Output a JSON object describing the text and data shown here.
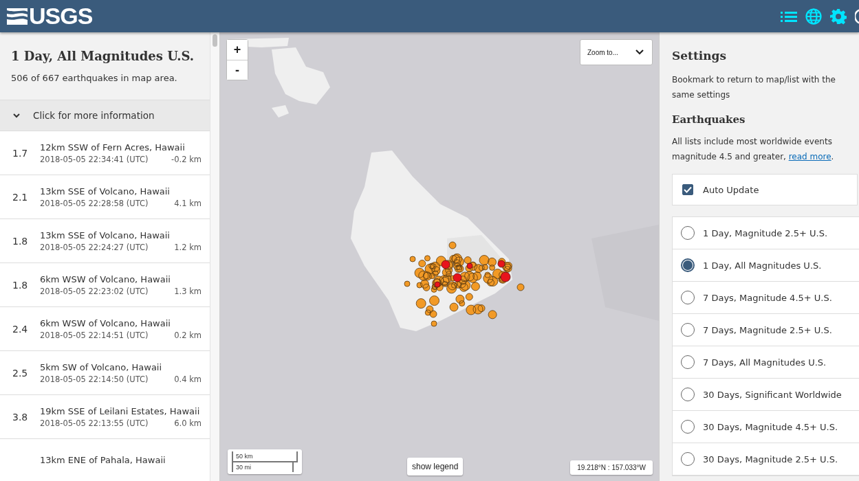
{
  "header": {
    "logo": "USGS"
  },
  "list_panel": {
    "title": "1 Day, All Magnitudes U.S.",
    "summary": "506 of 667 earthquakes in map area.",
    "info_toggle": {
      "label": "Click for more information",
      "expanded": false
    },
    "events": [
      {
        "magnitude": "1.7",
        "place": "12km SSW of Fern Acres, Hawaii",
        "time": "2018-05-05 22:34:41 (UTC)",
        "depth": "-0.2 km"
      },
      {
        "magnitude": "2.1",
        "place": "13km SSE of Volcano, Hawaii",
        "time": "2018-05-05 22:28:58 (UTC)",
        "depth": "4.1 km"
      },
      {
        "magnitude": "1.8",
        "place": "13km SSE of Volcano, Hawaii",
        "time": "2018-05-05 22:24:27 (UTC)",
        "depth": "1.2 km"
      },
      {
        "magnitude": "1.8",
        "place": "6km WSW of Volcano, Hawaii",
        "time": "2018-05-05 22:23:02 (UTC)",
        "depth": "1.3 km"
      },
      {
        "magnitude": "2.4",
        "place": "6km WSW of Volcano, Hawaii",
        "time": "2018-05-05 22:14:51 (UTC)",
        "depth": "0.2 km"
      },
      {
        "magnitude": "2.5",
        "place": "5km SW of Volcano, Hawaii",
        "time": "2018-05-05 22:14:50 (UTC)",
        "depth": "0.4 km"
      },
      {
        "magnitude": "3.8",
        "place": "19km SSE of Leilani Estates, Hawaii",
        "time": "2018-05-05 22:13:55 (UTC)",
        "depth": "6.0 km"
      },
      {
        "place": "13km ENE of Pahala, Hawaii"
      }
    ]
  },
  "map": {
    "zoom_in": "+",
    "zoom_out": "-",
    "zoom_to": "Zoom to...",
    "scale_km": "50 km",
    "scale_mi": "30 mi",
    "legend_button": "show legend",
    "coordinates": "19.218°N : 157.033°W"
  },
  "settings": {
    "title": "Settings",
    "bookmark_note": "Bookmark to return to map/list with the same settings",
    "section": "Earthquakes",
    "note_before": "All lists include most worldwide events magnitude 4.5 and greater, ",
    "note_link": "read more",
    "note_after": ".",
    "auto_update": {
      "label": "Auto Update",
      "checked": true
    },
    "feeds": [
      {
        "label": "1 Day, Magnitude 2.5+ U.S.",
        "selected": false
      },
      {
        "label": "1 Day, All Magnitudes U.S.",
        "selected": true
      },
      {
        "label": "7 Days, Magnitude 4.5+ U.S.",
        "selected": false
      },
      {
        "label": "7 Days, Magnitude 2.5+ U.S.",
        "selected": false
      },
      {
        "label": "7 Days, All Magnitudes U.S.",
        "selected": false
      },
      {
        "label": "30 Days, Significant Worldwide",
        "selected": false
      },
      {
        "label": "30 Days, Magnitude 4.5+ U.S.",
        "selected": false
      },
      {
        "label": "30 Days, Magnitude 2.5+ U.S.",
        "selected": false
      }
    ]
  }
}
